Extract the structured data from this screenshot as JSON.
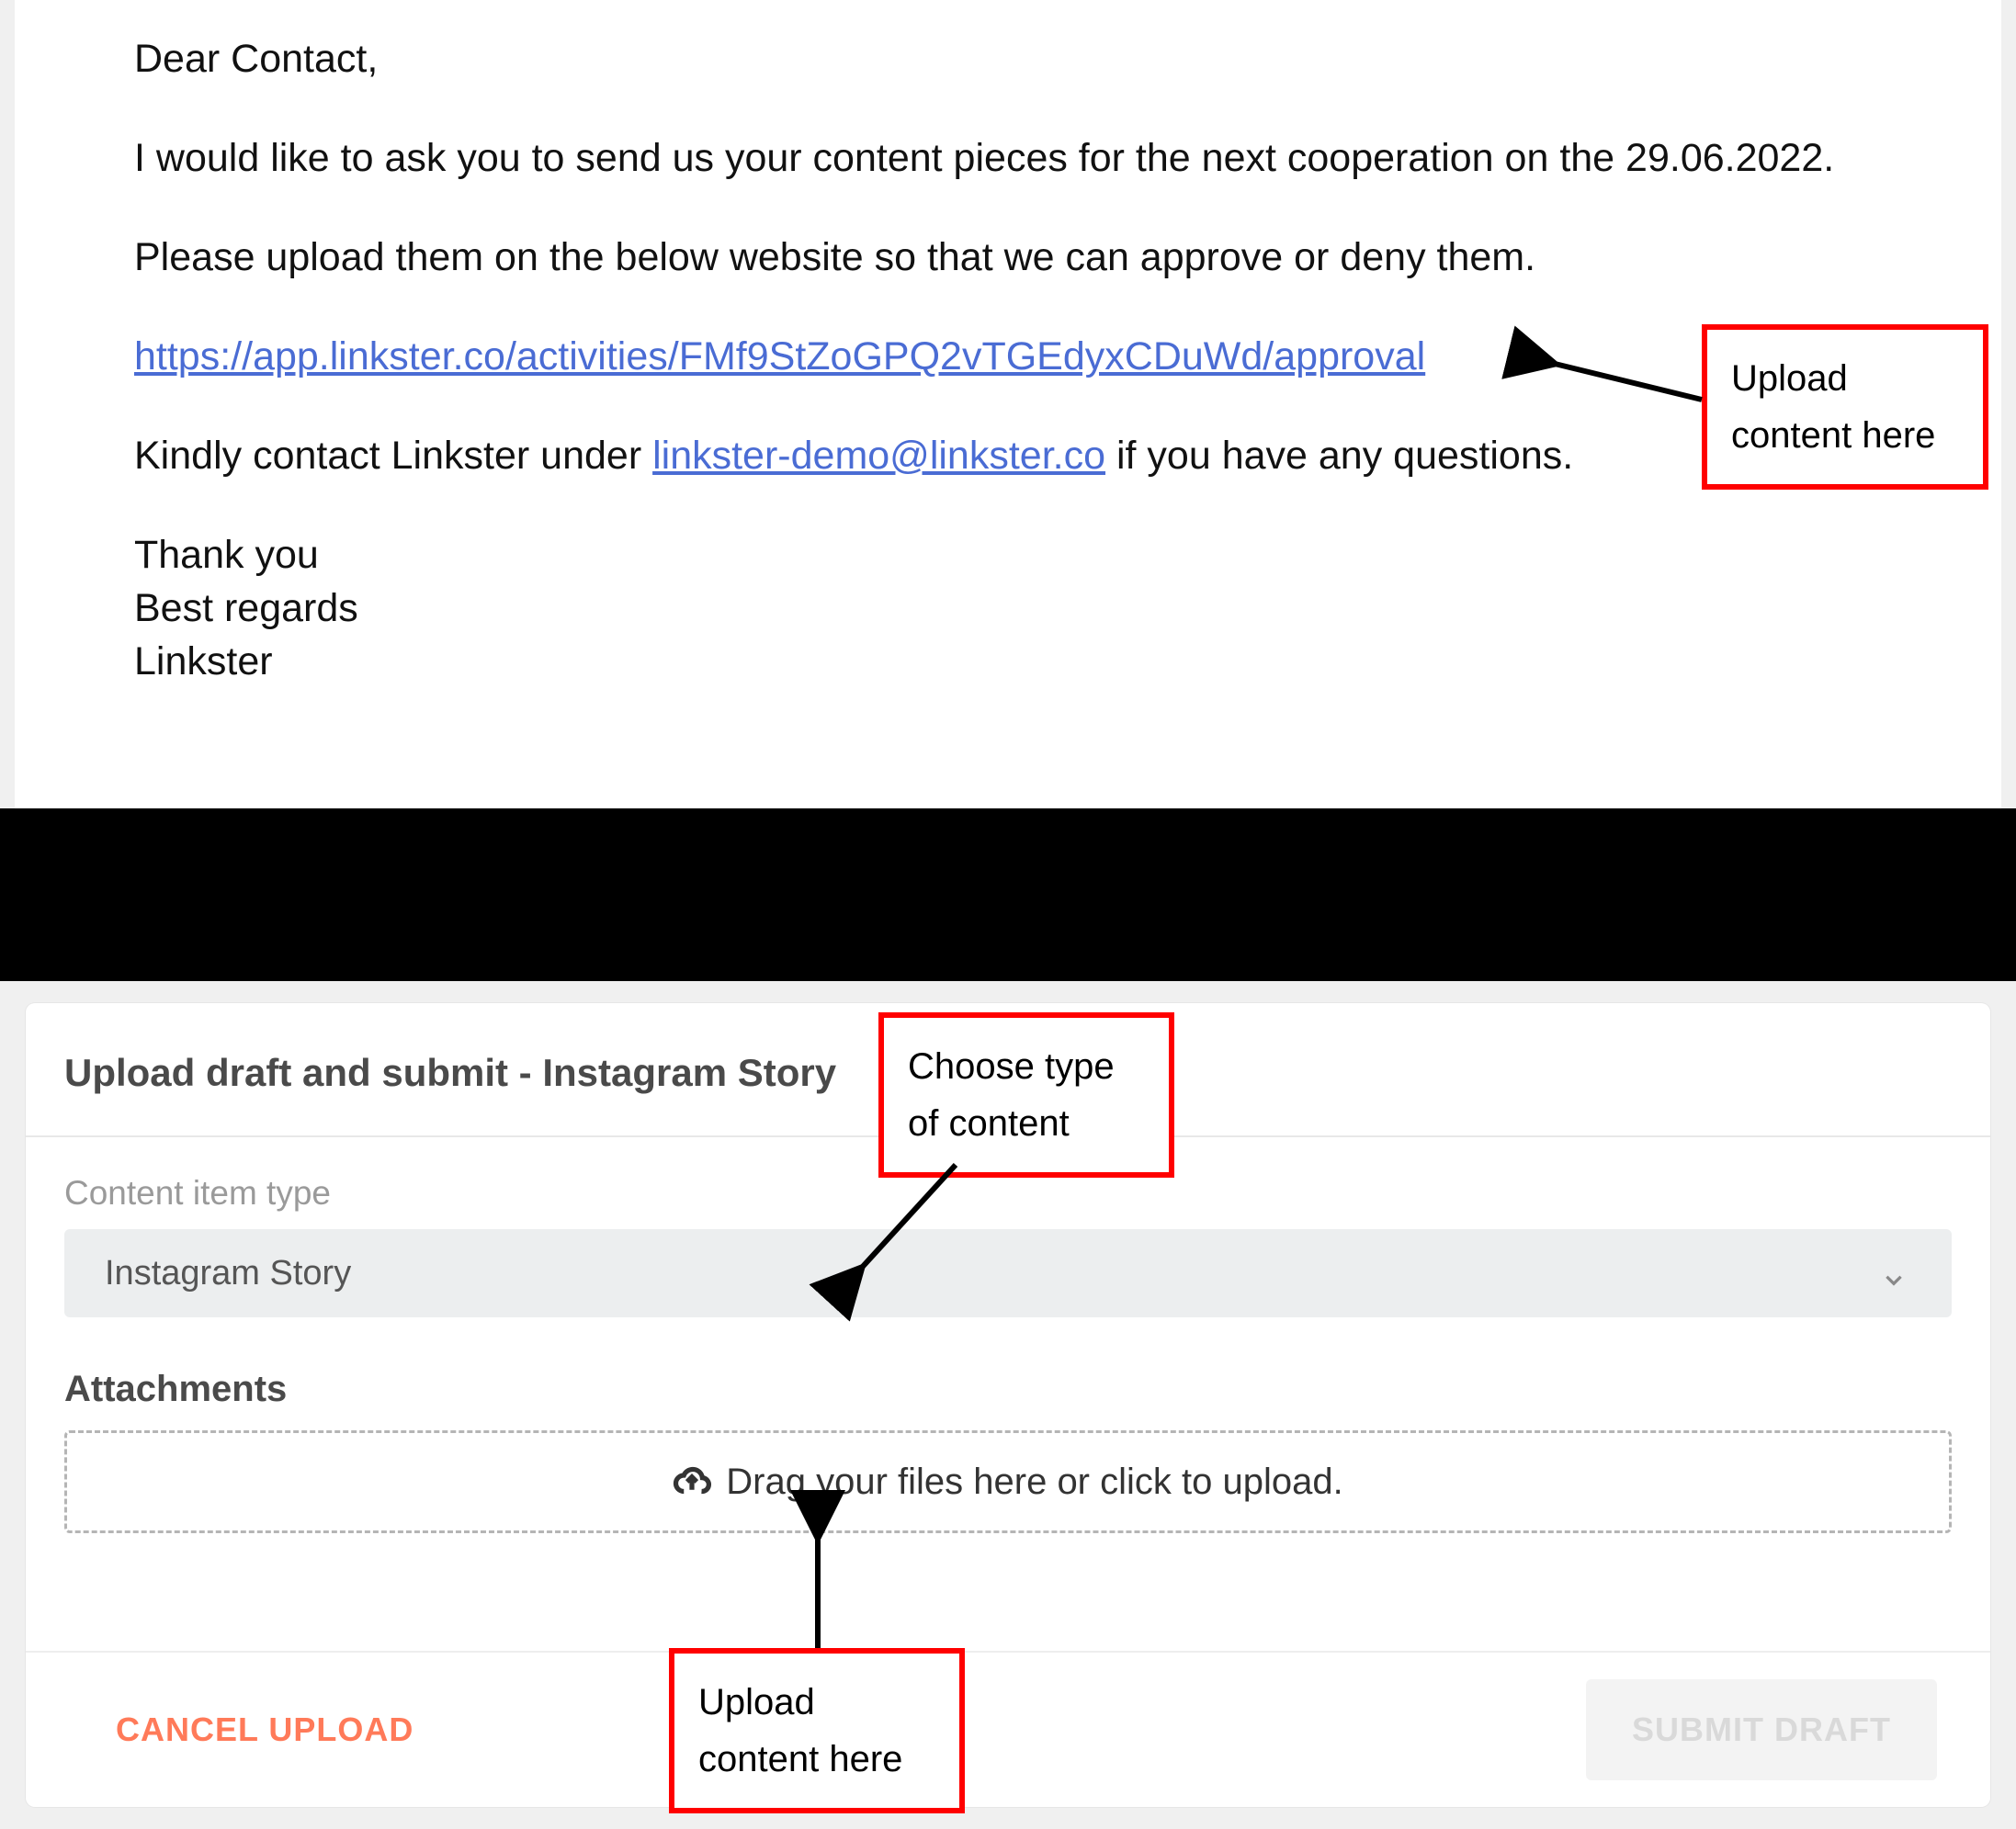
{
  "email": {
    "salutation": "Dear Contact,",
    "line1": "I would like to ask you to send us your content pieces for the next cooperation on the 29.06.2022.",
    "line2": "Please upload them on the below website so that we can approve or deny them.",
    "approval_url": "https://app.linkster.co/activities/FMf9StZoGPQ2vTGEdyxCDuWd/approval",
    "contact_pre": "Kindly contact Linkster under ",
    "contact_email": "linkster-demo@linkster.co",
    "contact_post": " if you have any questions.",
    "thanks": "Thank you",
    "regards": "Best regards",
    "sender": "Linkster"
  },
  "annotations": {
    "upload_here_1_l1": "Upload",
    "upload_here_1_l2": "content here",
    "choose_type_l1": "Choose type",
    "choose_type_l2": "of content",
    "upload_here_2_l1": "Upload",
    "upload_here_2_l2": "content here"
  },
  "panel": {
    "title": "Upload draft and submit - Instagram Story",
    "content_type_label": "Content item type",
    "content_type_value": "Instagram Story",
    "attachments_label": "Attachments",
    "dropzone_text": "Drag your files here or click to upload.",
    "cancel": "CANCEL UPLOAD",
    "submit": "SUBMIT DRAFT"
  }
}
